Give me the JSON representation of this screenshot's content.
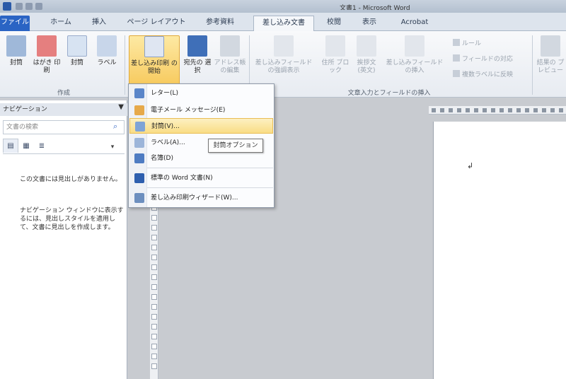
{
  "title_bar": {
    "window_title": "文書1 - Microsoft Word"
  },
  "tabs": [
    {
      "label": "ファイル"
    },
    {
      "label": "ホーム"
    },
    {
      "label": "挿入"
    },
    {
      "label": "ページ レイアウト"
    },
    {
      "label": "参考資料"
    },
    {
      "label": "差し込み文書"
    },
    {
      "label": "校閲"
    },
    {
      "label": "表示"
    },
    {
      "label": "Acrobat"
    }
  ],
  "ribbon": {
    "create": {
      "buttons": [
        {
          "label": "封筒"
        },
        {
          "label": "はがき 印刷"
        },
        {
          "label": "封筒"
        },
        {
          "label": "ラベル"
        }
      ],
      "group_label": "作成"
    },
    "start_merge": {
      "buttons": [
        {
          "label": "差し込み印刷 の開始"
        },
        {
          "label": "宛先の 選択"
        },
        {
          "label": "アドレス帳 の編集"
        }
      ]
    },
    "fields": {
      "buttons": [
        {
          "label": "差し込みフィールド の強調表示"
        },
        {
          "label": "住所 ブロック"
        },
        {
          "label": "挨拶文 (英文)"
        },
        {
          "label": "差し込みフィールド の挿入"
        }
      ],
      "small": [
        {
          "label": "ルール"
        },
        {
          "label": "フィールドの対応"
        },
        {
          "label": "複数ラベルに反映"
        }
      ],
      "group_label": "文章入力とフィールドの挿入"
    },
    "preview": {
      "label": "結果の プレビュー"
    }
  },
  "nav_pane": {
    "title": "ナビゲーション",
    "search_placeholder": "文書の検索",
    "text1": "この文書には見出しがありません。",
    "text2": "ナビゲーション ウィンドウに表示するには、見出しスタイルを適用して、文書に見出しを作成します。"
  },
  "menu": {
    "items": [
      {
        "label": "レター(L)"
      },
      {
        "label": "電子メール メッセージ(E)"
      },
      {
        "label": "封筒(V)..."
      },
      {
        "label": "ラベル(A)..."
      },
      {
        "label": "名簿(D)"
      },
      {
        "label": "標準の Word 文書(N)"
      },
      {
        "label": "差し込み印刷ウィザード(W)..."
      }
    ]
  },
  "tooltip": {
    "text": "封筒オプション"
  },
  "colors": {
    "file_tab": "#2a64c4",
    "highlight": "#f7c95c",
    "ribbon_bg": "#eef1f5"
  }
}
